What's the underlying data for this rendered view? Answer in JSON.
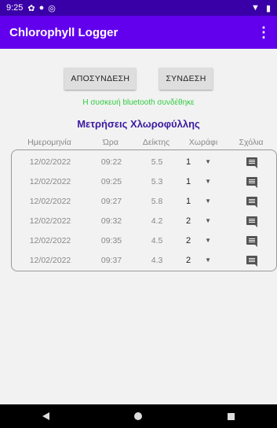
{
  "status_bar": {
    "time": "9:25"
  },
  "app": {
    "title": "Chlorophyll Logger"
  },
  "buttons": {
    "disconnect": "ΑΠΟΣΥΝΔΕΣΗ",
    "connect": "ΣΥΝΔΕΣΗ"
  },
  "status_message": "Η συσκευή bluetooth συνδέθηκε",
  "heading": "Μετρήσεις Χλωροφύλλης",
  "columns": {
    "date": "Ημερομηνία",
    "time": "Ώρα",
    "index": "Δείκτης",
    "field": "Χωράφι",
    "comments": "Σχόλια"
  },
  "rows": [
    {
      "date": "12/02/2022",
      "time": "09:22",
      "index": "5.5",
      "field": "1"
    },
    {
      "date": "12/02/2022",
      "time": "09:25",
      "index": "5.3",
      "field": "1"
    },
    {
      "date": "12/02/2022",
      "time": "09:27",
      "index": "5.8",
      "field": "1"
    },
    {
      "date": "12/02/2022",
      "time": "09:32",
      "index": "4.2",
      "field": "2"
    },
    {
      "date": "12/02/2022",
      "time": "09:35",
      "index": "4.5",
      "field": "2"
    },
    {
      "date": "12/02/2022",
      "time": "09:37",
      "index": "4.3",
      "field": "2"
    }
  ]
}
